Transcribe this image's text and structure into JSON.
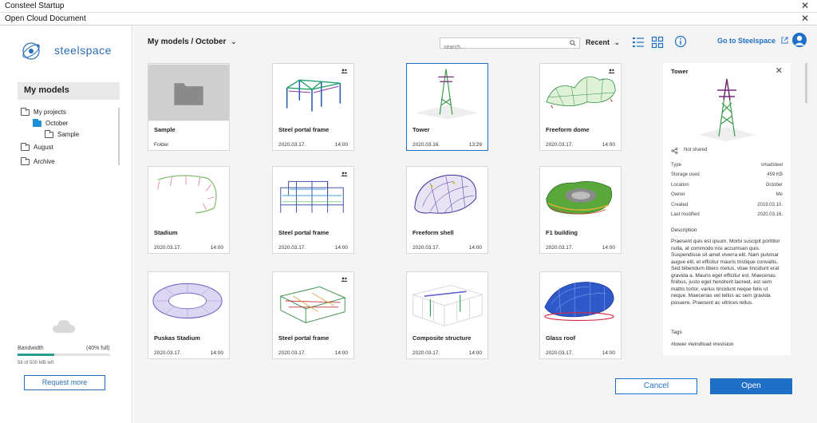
{
  "window": {
    "title": "Consteel Startup",
    "dialog_title": "Open Cloud Document"
  },
  "sidebar": {
    "logo_text": "steelspace",
    "section_title": "My models",
    "tree": {
      "my_projects": "My projects",
      "october": "October",
      "sample": "Sample",
      "august": "August",
      "archive": "Archive"
    },
    "bandwidth": {
      "label": "Bandwidth",
      "percent_text": "(40% full)",
      "fraction": 0.4,
      "left_text": "56 of 500 MB left"
    },
    "request_button": "Request more"
  },
  "toolbar": {
    "breadcrumb": "My models / October",
    "search_placeholder": "search...",
    "sort_label": "Recent",
    "goto_label": "Go to Steelspace"
  },
  "cards": [
    {
      "name": "Sample",
      "date": "Folder",
      "time": "",
      "shared": false,
      "kind": "folder"
    },
    {
      "name": "Steel portal frame",
      "date": "2020.03.17.",
      "time": "14:00",
      "shared": true,
      "kind": "portal"
    },
    {
      "name": "Tower",
      "date": "2020.03.16.",
      "time": "13:29",
      "shared": false,
      "kind": "tower"
    },
    {
      "name": "Freeform dome",
      "date": "2020.03.17.",
      "time": "14:00",
      "shared": true,
      "kind": "dome"
    },
    {
      "name": "Stadium",
      "date": "2020.03.17.",
      "time": "14:00",
      "shared": false,
      "kind": "stadium"
    },
    {
      "name": "Steel portal frame",
      "date": "2020.03.17.",
      "time": "14:00",
      "shared": true,
      "kind": "building"
    },
    {
      "name": "Freeform shell",
      "date": "2020.03.17.",
      "time": "14:00",
      "shared": false,
      "kind": "shell"
    },
    {
      "name": "F1 building",
      "date": "2020.03.17.",
      "time": "14:00",
      "shared": false,
      "kind": "f1"
    },
    {
      "name": "Puskas Stadium",
      "date": "2020.03.17.",
      "time": "14:00",
      "shared": false,
      "kind": "ring"
    },
    {
      "name": "Steel portal frame",
      "date": "2020.03.17.",
      "time": "14:00",
      "shared": true,
      "kind": "building2"
    },
    {
      "name": "Composite structure",
      "date": "2020.03.17.",
      "time": "14:00",
      "shared": false,
      "kind": "composite"
    },
    {
      "name": "Glass roof",
      "date": "2020.03.17.",
      "time": "14:00",
      "shared": false,
      "kind": "roof"
    }
  ],
  "detail": {
    "title": "Tower",
    "share_status": "Not shared",
    "rows": [
      {
        "key": "Type",
        "value": "smadsteel"
      },
      {
        "key": "Storage used",
        "value": "459 KB"
      },
      {
        "key": "Location",
        "value": "October"
      },
      {
        "key": "Owner",
        "value": "Me"
      },
      {
        "key": "Created",
        "value": "2019.03.10."
      },
      {
        "key": "Last modified",
        "value": "2020.03.16."
      }
    ],
    "description_label": "Description",
    "description": "Praesent quis est ipsum. Morbi suscipit porttitor nulla, at commodo nisi accumsan quis. Suspendisse sit amet viverra elit. Nam pulvinar augue elit, et efficitur mauris tristique convallis. Sed bibendum libero metus, vitae tincidunt erat gravida a. Mauris eget efficitur est. Maecenas finibus, justo eget hendrerit laoreet, est sem mattis tortor, varius tincidunt neque felis ut neque. Maecenas vel tellus ac sem gravida posuere. Praesent ac ultrices tellus.",
    "tags_label": "Tags",
    "tags": "#tower #windload #revision"
  },
  "footer": {
    "cancel_label": "Cancel",
    "open_label": "Open"
  },
  "colors": {
    "accent": "#1f6fc6",
    "bandwidth": "#2a9d8f"
  }
}
